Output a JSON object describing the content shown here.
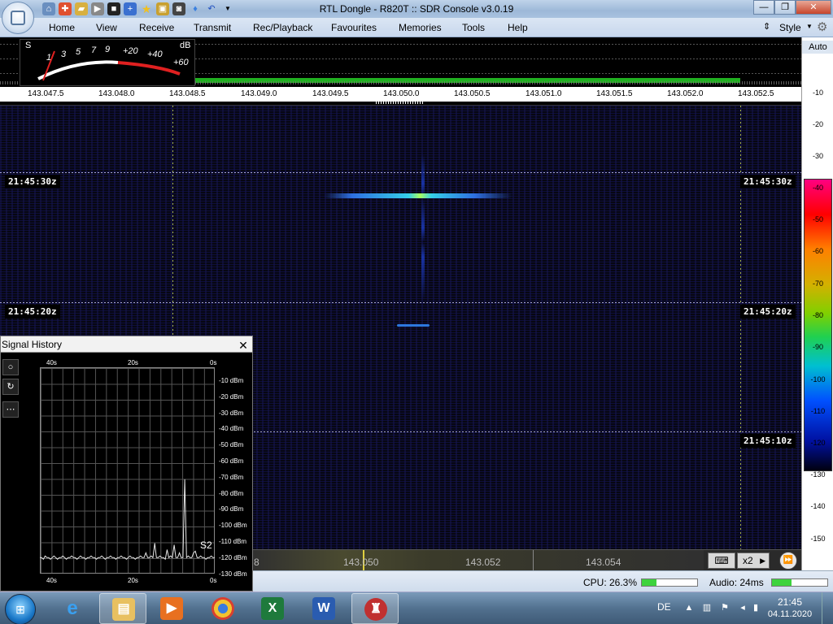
{
  "window": {
    "title": "RTL Dongle - R820T :: SDR Console v3.0.19"
  },
  "ribbon": {
    "tabs": [
      "Home",
      "View",
      "Receive",
      "Transmit",
      "Rec/Playback",
      "Favourites",
      "Memories",
      "Tools",
      "Help"
    ],
    "style_label": "Style"
  },
  "smeter": {
    "s_label": "S",
    "db_label": "dB",
    "s_scale": [
      "1",
      "3",
      "5",
      "7",
      "9"
    ],
    "plus_scale": [
      "+20",
      "+40",
      "+60"
    ]
  },
  "spectrum": {
    "freq_ticks": [
      "143.047.5",
      "143.048.0",
      "143.048.5",
      "143.049.0",
      "143.049.5",
      "143.050.0",
      "143.050.5",
      "143.051.0",
      "143.051.5",
      "143.052.0",
      "143.052.5"
    ]
  },
  "scale": {
    "auto_label": "Auto",
    "top_labels": [
      "-10",
      "-20",
      "-30"
    ],
    "colorbar_labels": [
      "-40",
      "-50",
      "-60",
      "-70",
      "-80",
      "-90",
      "-100",
      "-110",
      "-120"
    ],
    "bottom_labels": [
      "-130",
      "-140",
      "-150"
    ]
  },
  "waterfall": {
    "timestamps": [
      "21:45:30z",
      "21:45:20z",
      "21:45:10z"
    ]
  },
  "bottombar": {
    "freq_left_partial": "8",
    "freqs": [
      "143.050",
      "143.052",
      "143.054"
    ],
    "zoom_label": "x2"
  },
  "status": {
    "cpu_label": "CPU: 26.3%",
    "cpu_percent": 26.3,
    "audio_label": "Audio: 24ms",
    "audio_fraction": 0.35
  },
  "signal_history": {
    "title": "Signal History",
    "close_label": "✕",
    "x_labels_top": [
      "40s",
      "20s",
      "0s"
    ],
    "x_labels_bottom": [
      "40s",
      "20s",
      "0s"
    ],
    "y_labels": [
      "-10 dBm",
      "-20 dBm",
      "-30 dBm",
      "-40 dBm",
      "-50 dBm",
      "-60 dBm",
      "-70 dBm",
      "-80 dBm",
      "-90 dBm",
      "-100 dBm",
      "-110 dBm",
      "-120 dBm",
      "-130 dBm"
    ],
    "s_reading": "S2",
    "trace_dbm": [
      -121,
      -121,
      -122,
      -120,
      -121,
      -121,
      -122,
      -121,
      -120,
      -121,
      -122,
      -121,
      -121,
      -120,
      -121,
      -122,
      -121,
      -121,
      -120,
      -121,
      -121,
      -122,
      -121,
      -120,
      -121,
      -121,
      -122,
      -121,
      -121,
      -120,
      -121,
      -121,
      -122,
      -121,
      -121,
      -120,
      -121,
      -122,
      -121,
      -121,
      -120,
      -121,
      -121,
      -122,
      -121,
      -121,
      -120,
      -121,
      -121,
      -122,
      -121,
      -120,
      -121,
      -121,
      -122,
      -121,
      -121,
      -120,
      -121,
      -121,
      -118,
      -121,
      -121,
      -120,
      -121,
      -112,
      -121,
      -121,
      -120,
      -121,
      -121,
      -122,
      -116,
      -121,
      -120,
      -121,
      -113,
      -121,
      -121,
      -118,
      -121,
      -121,
      -72,
      -121,
      -120,
      -121,
      -121,
      -118,
      -117,
      -121,
      -121,
      -120,
      -121,
      -121,
      -122,
      -121,
      -121,
      -120,
      -121,
      -121
    ]
  },
  "taskbar": {
    "language": "DE",
    "time": "21:45",
    "date": "04.11.2020"
  }
}
